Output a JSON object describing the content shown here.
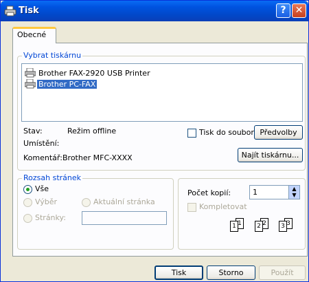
{
  "window": {
    "title": "Tisk"
  },
  "tabs": [
    {
      "label": "Obecné"
    }
  ],
  "printer_group": {
    "legend": "Vybrat tiskárnu",
    "printers": [
      {
        "label": "Brother FAX-2920 USB Printer",
        "selected": false
      },
      {
        "label": "Brother PC-FAX",
        "selected": true
      }
    ],
    "status_label": "Stav:",
    "status_value": "Režim offline",
    "location_label": "Umístění:",
    "location_value": "",
    "comment_label": "Komentář:",
    "comment_value": "Brother  MFC-XXXX",
    "print_to_file_label": "Tisk do souboru",
    "print_to_file_checked": false,
    "preferences_button": "Předvolby",
    "find_printer_button": "Najít tiskárnu..."
  },
  "range_group": {
    "legend": "Rozsah stránek",
    "all_label": "Vše",
    "selection_label": "Výběr",
    "current_page_label": "Aktuální stránka",
    "pages_label": "Stránky:",
    "pages_value": ""
  },
  "copies_group": {
    "copies_label": "Počet kopií:",
    "copies_value": "1",
    "collate_label": "Kompletovat",
    "collate_pages": [
      "1",
      "1",
      "2",
      "2",
      "3",
      "3"
    ]
  },
  "footer": {
    "print_button": "Tisk",
    "cancel_button": "Storno",
    "apply_button": "Použít"
  }
}
